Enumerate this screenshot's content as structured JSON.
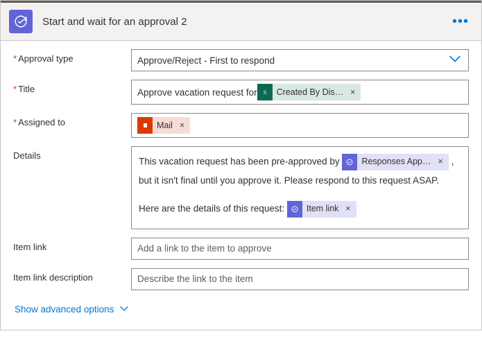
{
  "header": {
    "title": "Start and wait for an approval 2"
  },
  "labels": {
    "approvalType": "Approval type",
    "title": "Title",
    "assignedTo": "Assigned to",
    "details": "Details",
    "itemLink": "Item link",
    "itemLinkDescription": "Item link description"
  },
  "approvalType": {
    "selected": "Approve/Reject - First to respond"
  },
  "title": {
    "prefixText": "Approve vacation request for ",
    "token": {
      "label": "Created By Dis…"
    }
  },
  "assignedTo": {
    "token": {
      "label": "Mail"
    }
  },
  "details": {
    "line1a": "This vacation request has been pre-approved by ",
    "token1": {
      "label": "Responses App…"
    },
    "line1b": ",",
    "line2": "but it isn't final until you approve it. Please respond to this request ASAP.",
    "line3a": "Here are the details of this request: ",
    "token2": {
      "label": "Item link"
    }
  },
  "itemLink": {
    "placeholder": "Add a link to the item to approve"
  },
  "itemLinkDesc": {
    "placeholder": "Describe the link to the item"
  },
  "advanced": {
    "label": "Show advanced options"
  }
}
